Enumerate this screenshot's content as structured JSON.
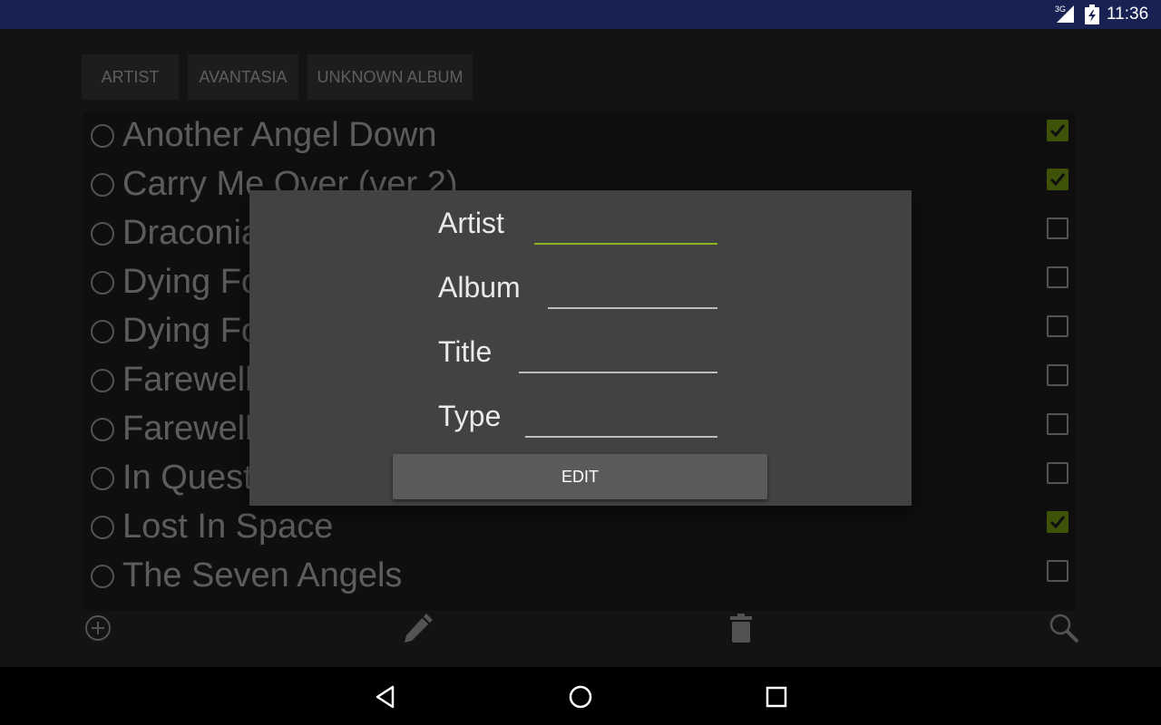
{
  "status_bar": {
    "network_label": "3G",
    "time": "11:36",
    "icons": [
      "signal-3g-icon",
      "battery-charging-icon"
    ]
  },
  "breadcrumbs": [
    "ARTIST",
    "AVANTASIA",
    "UNKNOWN ALBUM"
  ],
  "songs": [
    {
      "title": "Another Angel Down",
      "checked": true
    },
    {
      "title": "Carry Me Over (ver 2)",
      "checked": true
    },
    {
      "title": "Draconian Love",
      "checked": false
    },
    {
      "title": "Dying For An Angel",
      "checked": false
    },
    {
      "title": "Dying For An Angel (ver 2)",
      "checked": false
    },
    {
      "title": "Farewell",
      "checked": false
    },
    {
      "title": "Farewell (ver 2)",
      "checked": false
    },
    {
      "title": "In Quest For",
      "checked": false
    },
    {
      "title": "Lost In Space",
      "checked": true
    },
    {
      "title": "The Seven Angels",
      "checked": false
    }
  ],
  "toolbar": {
    "icons": [
      "add-circle-icon",
      "pencil-icon",
      "trash-icon",
      "search-icon"
    ]
  },
  "dialog": {
    "fields": {
      "artist": {
        "label": "Artist",
        "value": ""
      },
      "album": {
        "label": "Album",
        "value": ""
      },
      "title": {
        "label": "Title",
        "value": ""
      },
      "type": {
        "label": "Type",
        "value": ""
      }
    },
    "button_label": "EDIT",
    "accent_color": "#8bb51a"
  },
  "colors": {
    "status_bar": "#182252",
    "checkbox_on": "#9ccc1a",
    "dialog_bg": "#424242"
  },
  "nav_bar": {
    "icons": [
      "back-triangle-icon",
      "home-circle-icon",
      "recent-square-icon"
    ]
  }
}
